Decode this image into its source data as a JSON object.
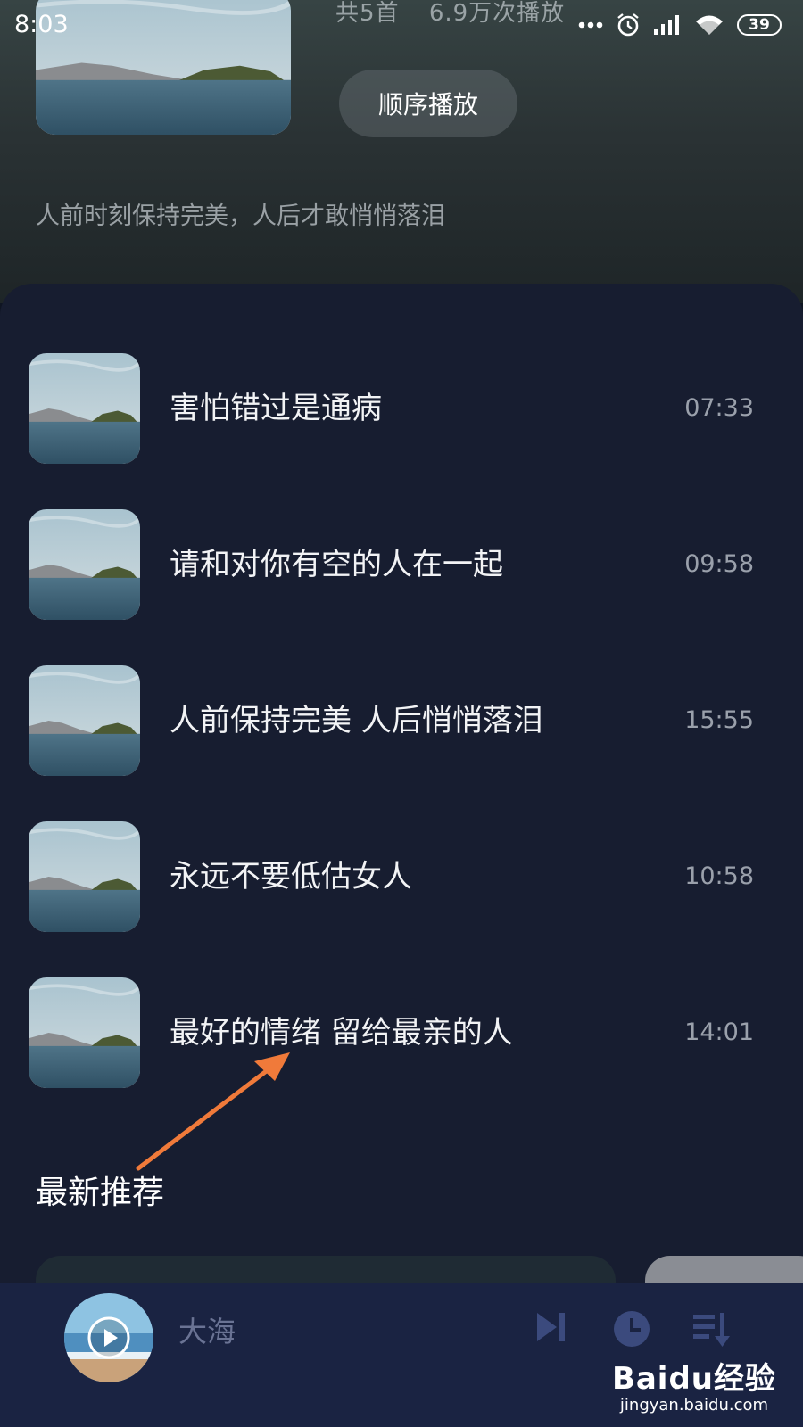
{
  "status_bar": {
    "time": "8:03",
    "battery": "39"
  },
  "album": {
    "track_count": "共5首",
    "play_count": "6.9万次播放",
    "play_order_label": "顺序播放",
    "description": "人前时刻保持完美，人后才敢悄悄落泪"
  },
  "songs": [
    {
      "title": "害怕错过是通病",
      "duration": "07:33"
    },
    {
      "title": "请和对你有空的人在一起",
      "duration": "09:58"
    },
    {
      "title": "人前保持完美 人后悄悄落泪",
      "duration": "15:55"
    },
    {
      "title": "永远不要低估女人",
      "duration": "10:58"
    },
    {
      "title": "最好的情绪 留给最亲的人",
      "duration": "14:01"
    }
  ],
  "recommend": {
    "title": "最新推荐"
  },
  "player": {
    "title": "大海"
  },
  "watermark": {
    "brand": "Baidu经验",
    "domain": "jingyan.baidu.com"
  },
  "colors": {
    "accent": "#3b4a7d",
    "annotation_arrow": "#f07a3a",
    "panel": "#171d30"
  },
  "icons": [
    "more-icon",
    "alarm-icon",
    "signal-icon",
    "wifi-icon",
    "battery-icon",
    "play-icon",
    "next-icon",
    "timer-icon",
    "playlist-icon"
  ]
}
